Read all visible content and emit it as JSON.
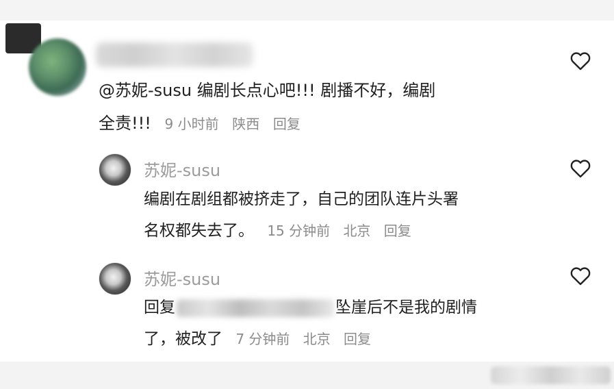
{
  "comment": {
    "text_line1": "@苏妮-susu  编剧长点心吧!!!  剧播不好，编剧",
    "text_line2": "全责!!!",
    "time": "9 小时前",
    "location": "陕西",
    "reply_label": "回复"
  },
  "replies": [
    {
      "username": "苏妮-susu",
      "text_line1": "编剧在剧组都被挤走了，自己的团队连片头署",
      "text_line2": "名权都失去了。",
      "time": "15 分钟前",
      "location": "北京",
      "reply_label": "回复"
    },
    {
      "username": "苏妮-susu",
      "text_prefix": "回复",
      "text_suffix": "坠崖后不是我的剧情",
      "text_line2": "了，被改了",
      "time": "7 分钟前",
      "location": "北京",
      "reply_label": "回复"
    }
  ],
  "icons": {
    "like": "heart-outline-icon"
  },
  "colors": {
    "text": "#1f1f1f",
    "meta": "#8b8b8b",
    "username": "#9b9b9b"
  }
}
